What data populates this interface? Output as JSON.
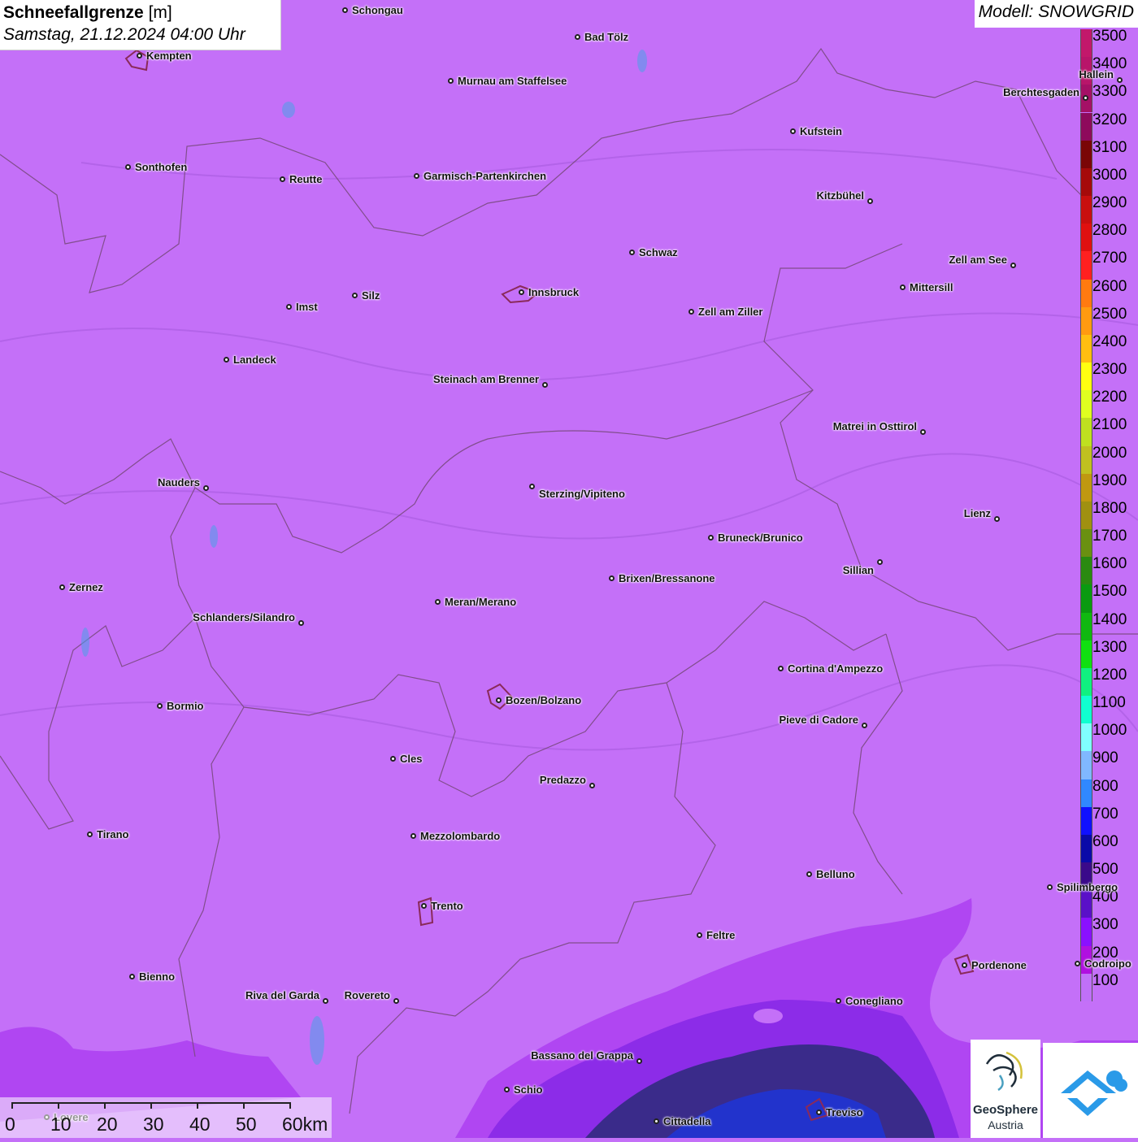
{
  "header": {
    "title_bold": "Schneefallgrenze",
    "title_unit": "[m]",
    "datetime": "Samstag, 21.12.2024 04:00 Uhr",
    "model": "Modell: SNOWGRID"
  },
  "legend": {
    "labels": [
      "3500",
      "3400",
      "3300",
      "3200",
      "3100",
      "3000",
      "2900",
      "2800",
      "2700",
      "2600",
      "2500",
      "2400",
      "2300",
      "2200",
      "2100",
      "2000",
      "1900",
      "1800",
      "1700",
      "1600",
      "1500",
      "1400",
      "1300",
      "1200",
      "1100",
      "1000",
      "900",
      "800",
      "700",
      "600",
      "500",
      "400",
      "300",
      "200",
      "100"
    ],
    "colors": [
      "#c2186b",
      "#b8156a",
      "#a51066",
      "#8e0a5c",
      "#7a0606",
      "#a50a0a",
      "#c80f0f",
      "#e01010",
      "#ff2020",
      "#ff7a10",
      "#ff9a10",
      "#ffbe10",
      "#ffff10",
      "#e0ff20",
      "#bfe020",
      "#c0c020",
      "#c09810",
      "#a09010",
      "#6a9010",
      "#2a8a10",
      "#0a9a10",
      "#10b810",
      "#10e010",
      "#10f080",
      "#10ffd0",
      "#80ffff",
      "#80b8ff",
      "#3088ff",
      "#1010ff",
      "#0a0aa8",
      "#3a0a8a",
      "#5a10c8",
      "#8a10ff",
      "#b010e0",
      "#c070f8"
    ]
  },
  "cities": [
    {
      "name": "Schongau"
    },
    {
      "name": "Bad Tölz"
    },
    {
      "name": "Kempten"
    },
    {
      "name": "Murnau am Staffelsee"
    },
    {
      "name": "Berchtesgaden"
    },
    {
      "name": "Hallein"
    },
    {
      "name": "Kufstein"
    },
    {
      "name": "Sonthofen"
    },
    {
      "name": "Reutte"
    },
    {
      "name": "Garmisch-Partenkirchen"
    },
    {
      "name": "Kitzbühel"
    },
    {
      "name": "Schwaz"
    },
    {
      "name": "Zell am See"
    },
    {
      "name": "Innsbruck"
    },
    {
      "name": "Mittersill"
    },
    {
      "name": "Imst"
    },
    {
      "name": "Silz"
    },
    {
      "name": "Zell am Ziller"
    },
    {
      "name": "Landeck"
    },
    {
      "name": "Steinach am Brenner"
    },
    {
      "name": "Matrei in Osttirol"
    },
    {
      "name": "Nauders"
    },
    {
      "name": "Sterzing/Vipiteno"
    },
    {
      "name": "Lienz"
    },
    {
      "name": "Bruneck/Brunico"
    },
    {
      "name": "Sillian"
    },
    {
      "name": "Zernez"
    },
    {
      "name": "Brixen/Bressanone"
    },
    {
      "name": "Meran/Merano"
    },
    {
      "name": "Schlanders/Silandro"
    },
    {
      "name": "Cortina d'Ampezzo"
    },
    {
      "name": "Bormio"
    },
    {
      "name": "Bozen/Bolzano"
    },
    {
      "name": "Pieve di Cadore"
    },
    {
      "name": "Cles"
    },
    {
      "name": "Predazzo"
    },
    {
      "name": "Tirano"
    },
    {
      "name": "Mezzolombardo"
    },
    {
      "name": "Belluno"
    },
    {
      "name": "Spilimbergo"
    },
    {
      "name": "Trento"
    },
    {
      "name": "Feltre"
    },
    {
      "name": "Pordenone"
    },
    {
      "name": "Bienno"
    },
    {
      "name": "Riva del Garda"
    },
    {
      "name": "Rovereto"
    },
    {
      "name": "Conegliano"
    },
    {
      "name": "Bassano del Grappa"
    },
    {
      "name": "Schio"
    },
    {
      "name": "Treviso"
    },
    {
      "name": "Cittadella"
    },
    {
      "name": "Lovere"
    },
    {
      "name": "Codroipo"
    }
  ],
  "scale": {
    "labels": [
      "0",
      "10",
      "20",
      "30",
      "40",
      "50",
      "60km"
    ]
  },
  "logo": {
    "line1": "GeoSphere",
    "line2": "Austria"
  },
  "colors": {
    "background": "#c470f8",
    "low_band": "#b046f2",
    "lower_band": "#8c2ce8",
    "core": "#3a2b8a",
    "blue": "#2233cc",
    "border": "#7a4a80"
  }
}
